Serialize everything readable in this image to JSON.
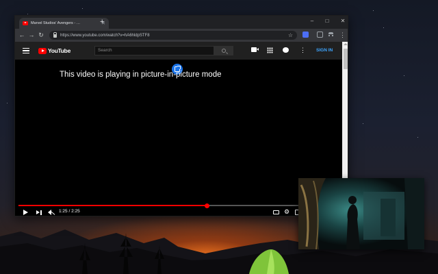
{
  "browser": {
    "tab_title": "Marvel Studios' Avengers - …",
    "tab_close_icon": "close-icon",
    "new_tab_icon": "plus-icon",
    "url": "https://www.youtube.com/watch?v=hA6hldpSTF8",
    "window_controls": {
      "minimize": "–",
      "maximize": "□",
      "close": "✕"
    }
  },
  "youtube": {
    "logo_text": "YouTube",
    "search_placeholder": "Search",
    "sign_in": "SIGN IN"
  },
  "video": {
    "pip_message": "This video is playing in picture-in-picture mode",
    "time_display": "1:25 / 2:25",
    "current_seconds": 85,
    "duration_seconds": 145
  },
  "colors": {
    "progress": "#ff0000",
    "sign_in": "#3ea6ff",
    "pip_badge": "#1a73e8"
  }
}
